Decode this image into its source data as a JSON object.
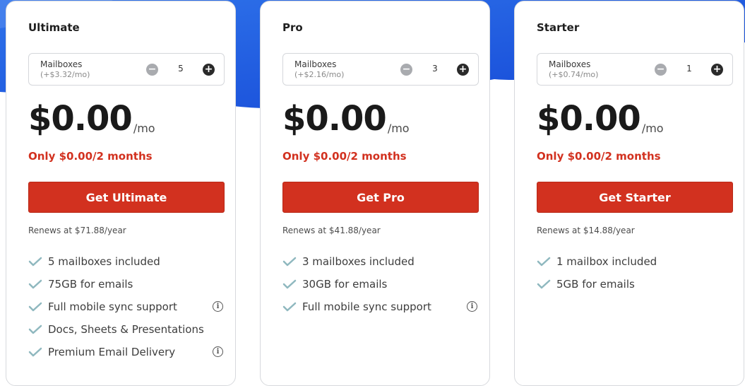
{
  "colors": {
    "accent_red": "#d2311f",
    "background_blue": "#1f5fe0",
    "check_color": "#8fb8bf"
  },
  "plans": [
    {
      "title": "Ultimate",
      "mailbox_label": "Mailboxes",
      "mailbox_price": "(+$3.32/mo)",
      "quantity": "5",
      "price": "$0.00",
      "price_unit": "/mo",
      "promo": "Only $0.00/2 months",
      "cta": "Get Ultimate",
      "renews": "Renews at $71.88/year",
      "features": [
        {
          "text": "5 mailboxes included",
          "info": false
        },
        {
          "text": "75GB for emails",
          "info": false
        },
        {
          "text": "Full mobile sync support",
          "info": true
        },
        {
          "text": "Docs, Sheets & Presentations",
          "info": false
        },
        {
          "text": "Premium Email Delivery",
          "info": true
        }
      ]
    },
    {
      "title": "Pro",
      "mailbox_label": "Mailboxes",
      "mailbox_price": "(+$2.16/mo)",
      "quantity": "3",
      "price": "$0.00",
      "price_unit": "/mo",
      "promo": "Only $0.00/2 months",
      "cta": "Get Pro",
      "renews": "Renews at $41.88/year",
      "features": [
        {
          "text": "3 mailboxes included",
          "info": false
        },
        {
          "text": "30GB for emails",
          "info": false
        },
        {
          "text": "Full mobile sync support",
          "info": true
        }
      ]
    },
    {
      "title": "Starter",
      "mailbox_label": "Mailboxes",
      "mailbox_price": "(+$0.74/mo)",
      "quantity": "1",
      "price": "$0.00",
      "price_unit": "/mo",
      "promo": "Only $0.00/2 months",
      "cta": "Get Starter",
      "renews": "Renews at $14.88/year",
      "features": [
        {
          "text": "1 mailbox included",
          "info": false
        },
        {
          "text": "5GB for emails",
          "info": false
        }
      ]
    }
  ],
  "icons": {
    "minus": "minus-circle-icon",
    "plus": "plus-circle-icon",
    "check": "check-icon",
    "info": "info-icon"
  }
}
